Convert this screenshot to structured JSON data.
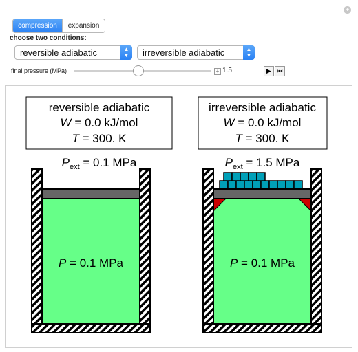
{
  "mode_tabs": [
    {
      "label": "compression",
      "selected": true
    },
    {
      "label": "expansion",
      "selected": false
    }
  ],
  "conditions": {
    "caption": "choose two conditions:",
    "left_selected": "reversible adiabatic",
    "right_selected": "irreversible adiabatic"
  },
  "pressure": {
    "label": "final pressure (MPa)",
    "value": "1.5",
    "fraction": 0.47
  },
  "left": {
    "title": "reversible adiabatic",
    "W_value": "= 0.0 kJ/mol",
    "T_value": "= 300. K",
    "pext_value": "= 0.1 MPa",
    "P_value": "= 0.1 MPa",
    "weights": 0
  },
  "right": {
    "title": "irreversible adiabatic",
    "W_value": "= 0.0 kJ/mol",
    "T_value": "= 300. K",
    "pext_value": "= 1.5 MPa",
    "P_value": "= 0.1 MPa",
    "weights": 15
  },
  "symbols": {
    "W": "W",
    "T": "T",
    "P": "P",
    "Pext": "P",
    "ext": "ext"
  },
  "colors": {
    "gas": "#66ff88",
    "piston": "#666666",
    "weight": "#00a0b8",
    "stop": "#cc0000",
    "accent": "#2b82f4"
  }
}
